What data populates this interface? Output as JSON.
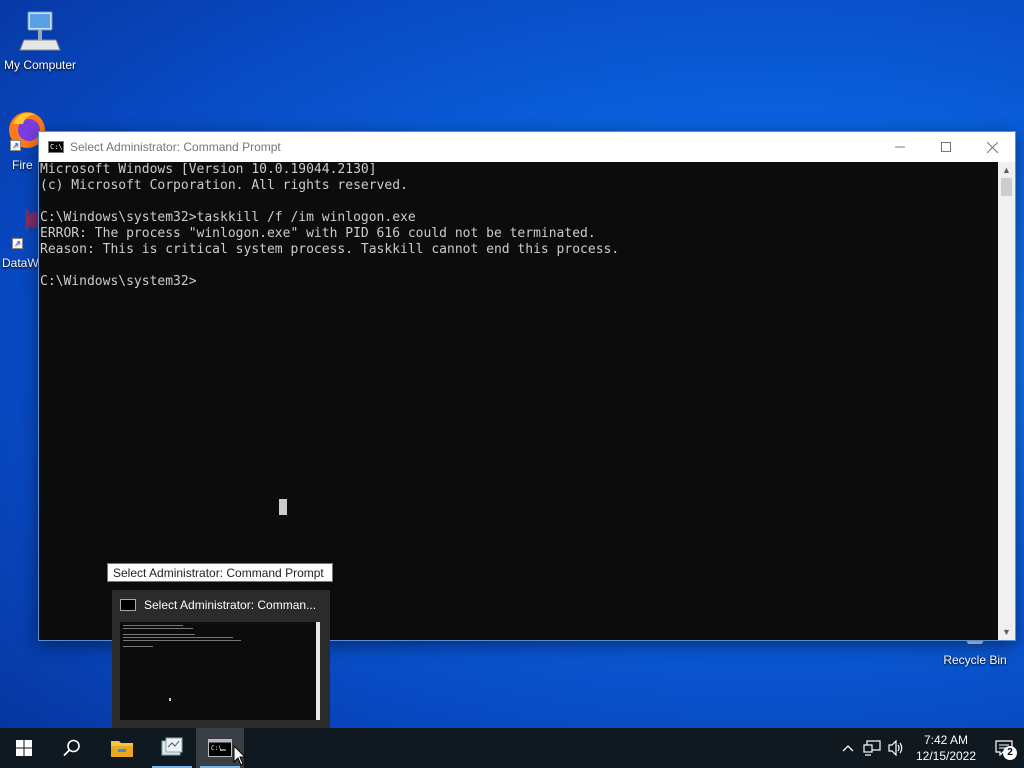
{
  "desktop": {
    "icons": [
      {
        "label": "My Computer",
        "icon": "computer-icon"
      },
      {
        "label": "Fire",
        "icon": "firefox-icon"
      },
      {
        "label": "DataW",
        "icon": "app-icon"
      },
      {
        "label": "Recycle Bin",
        "icon": "recycle-bin-icon"
      }
    ]
  },
  "window": {
    "title": "Select Administrator: Command Prompt",
    "icon_text": "C:\\."
  },
  "console": {
    "lines": [
      "Microsoft Windows [Version 10.0.19044.2130]",
      "(c) Microsoft Corporation. All rights reserved.",
      "",
      "C:\\Windows\\system32>taskkill /f /im winlogon.exe",
      "ERROR: The process \"winlogon.exe\" with PID 616 could not be terminated.",
      "Reason: This is critical system process. Taskkill cannot end this process.",
      "",
      "C:\\Windows\\system32>"
    ]
  },
  "tooltip": {
    "text": "Select Administrator: Command Prompt"
  },
  "thumbnail": {
    "title": "Select Administrator: Comman..."
  },
  "taskbar": {
    "items": [
      {
        "name": "start-button",
        "icon": "windows-logo-icon"
      },
      {
        "name": "search-button",
        "icon": "search-icon"
      },
      {
        "name": "file-explorer",
        "icon": "folder-icon"
      },
      {
        "name": "app-taskbar-item",
        "icon": "app-icon"
      },
      {
        "name": "command-prompt",
        "icon": "cmd-icon"
      }
    ],
    "tray": {
      "time": "7:42 AM",
      "date": "12/15/2022",
      "notification_count": "2"
    }
  },
  "colors": {
    "console_bg": "#0c0c0c",
    "console_text": "#cccccc",
    "taskbar_bg": "#101820",
    "desktop_accent": "#0a63e0"
  }
}
